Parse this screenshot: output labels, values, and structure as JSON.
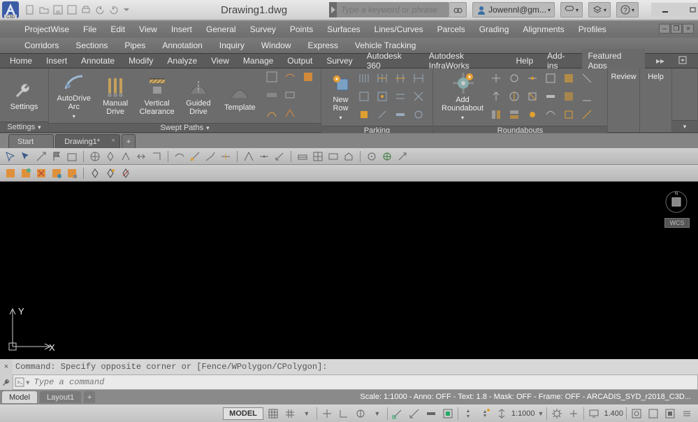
{
  "title": "Drawing1.dwg",
  "search": {
    "placeholder": "Type a keyword or phrase"
  },
  "user": {
    "name": "Jowennl@gm..."
  },
  "menubar1": [
    "ProjectWise",
    "File",
    "Edit",
    "View",
    "Insert",
    "General",
    "Survey",
    "Points",
    "Surfaces",
    "Lines/Curves",
    "Parcels",
    "Grading",
    "Alignments",
    "Profiles"
  ],
  "menubar2": [
    "Corridors",
    "Sections",
    "Pipes",
    "Annotation",
    "Inquiry",
    "Window",
    "Express",
    "Vehicle Tracking"
  ],
  "ribtabs": [
    "Home",
    "Insert",
    "Annotate",
    "Modify",
    "Analyze",
    "View",
    "Manage",
    "Output",
    "Survey",
    "Autodesk 360",
    "Autodesk InfraWorks",
    "Help",
    "Add-ins",
    "Featured Apps"
  ],
  "panels": {
    "settings": {
      "title": "Settings",
      "btn": "Settings"
    },
    "swept": {
      "title": "Swept Paths",
      "auto": "AutoDrive\nArc",
      "manual": "Manual\nDrive",
      "vert": "Vertical\nClearance",
      "guided": "Guided\nDrive",
      "templ": "Template"
    },
    "parking": {
      "title": "Parking",
      "newrow": "New\nRow"
    },
    "round": {
      "title": "Roundabouts",
      "add": "Add\nRoundabout"
    },
    "review": "Review",
    "help": "Help"
  },
  "filetabs": {
    "start": "Start",
    "drawing": "Drawing1*"
  },
  "command": {
    "history": "Command: Specify opposite corner or [Fence/WPolygon/CPolygon]:",
    "placeholder": "Type a command"
  },
  "layouttabs": {
    "model": "Model",
    "layout1": "Layout1"
  },
  "layoutinfo": "Scale: 1:1000 - Anno: OFF - Text: 1.8 - Mask: OFF - Frame: OFF - ARCADIS_SYD_r2018_C3D...",
  "status": {
    "model": "MODEL",
    "scale": "1:1000",
    "num": "1.400"
  },
  "wcs": "WCS",
  "ucs": {
    "x": "X",
    "y": "Y"
  }
}
